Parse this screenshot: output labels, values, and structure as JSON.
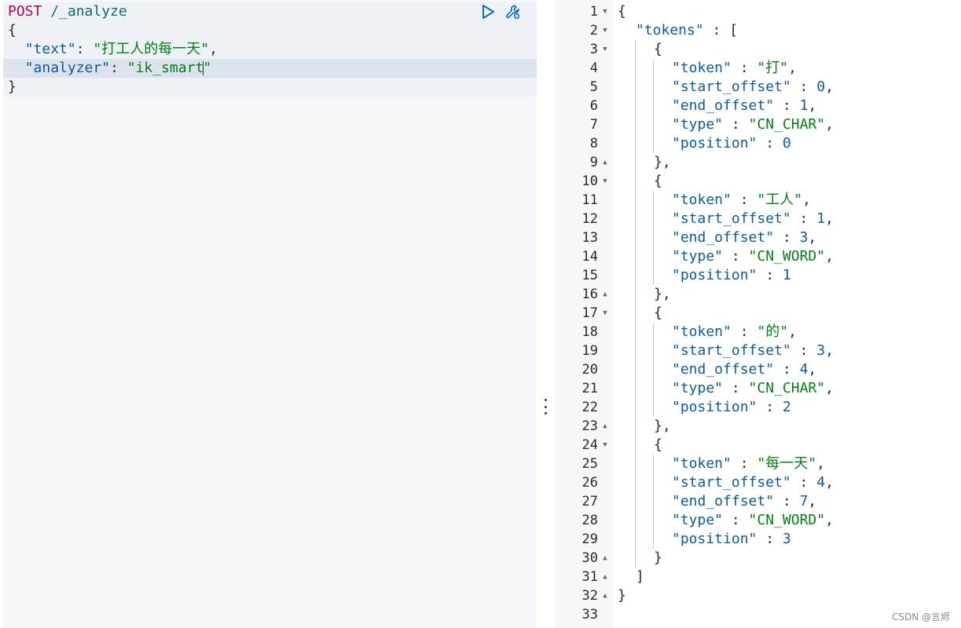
{
  "request": {
    "method": "POST",
    "path": " /_analyze",
    "open_brace": "{",
    "text_key": "\"text\"",
    "text_value": "\"打工人的每一天\"",
    "analyzer_key": "\"analyzer\"",
    "analyzer_value_before_cursor": "\"ik_smart",
    "analyzer_value_after_cursor": "\"",
    "close_brace": "}"
  },
  "toolbar": {
    "run_icon": "play-icon",
    "settings_icon": "wrench-icon"
  },
  "response": {
    "line_numbers": [
      "1",
      "2",
      "3",
      "4",
      "5",
      "6",
      "7",
      "8",
      "9",
      "10",
      "11",
      "12",
      "13",
      "14",
      "15",
      "16",
      "17",
      "18",
      "19",
      "20",
      "21",
      "22",
      "23",
      "24",
      "25",
      "26",
      "27",
      "28",
      "29",
      "30",
      "31",
      "32",
      "33"
    ],
    "tokens_key": "\"tokens\"",
    "tokens": [
      {
        "token": "\"打\"",
        "start_offset": "0",
        "end_offset": "1",
        "type": "\"CN_CHAR\"",
        "position": "0"
      },
      {
        "token": "\"工人\"",
        "start_offset": "1",
        "end_offset": "3",
        "type": "\"CN_WORD\"",
        "position": "1"
      },
      {
        "token": "\"的\"",
        "start_offset": "3",
        "end_offset": "4",
        "type": "\"CN_CHAR\"",
        "position": "2"
      },
      {
        "token": "\"每一天\"",
        "start_offset": "4",
        "end_offset": "7",
        "type": "\"CN_WORD\"",
        "position": "3"
      }
    ],
    "labels": {
      "token": "\"token\"",
      "start_offset": "\"start_offset\"",
      "end_offset": "\"end_offset\"",
      "type": "\"type\"",
      "position": "\"position\""
    }
  },
  "watermark": "CSDN @言烬"
}
